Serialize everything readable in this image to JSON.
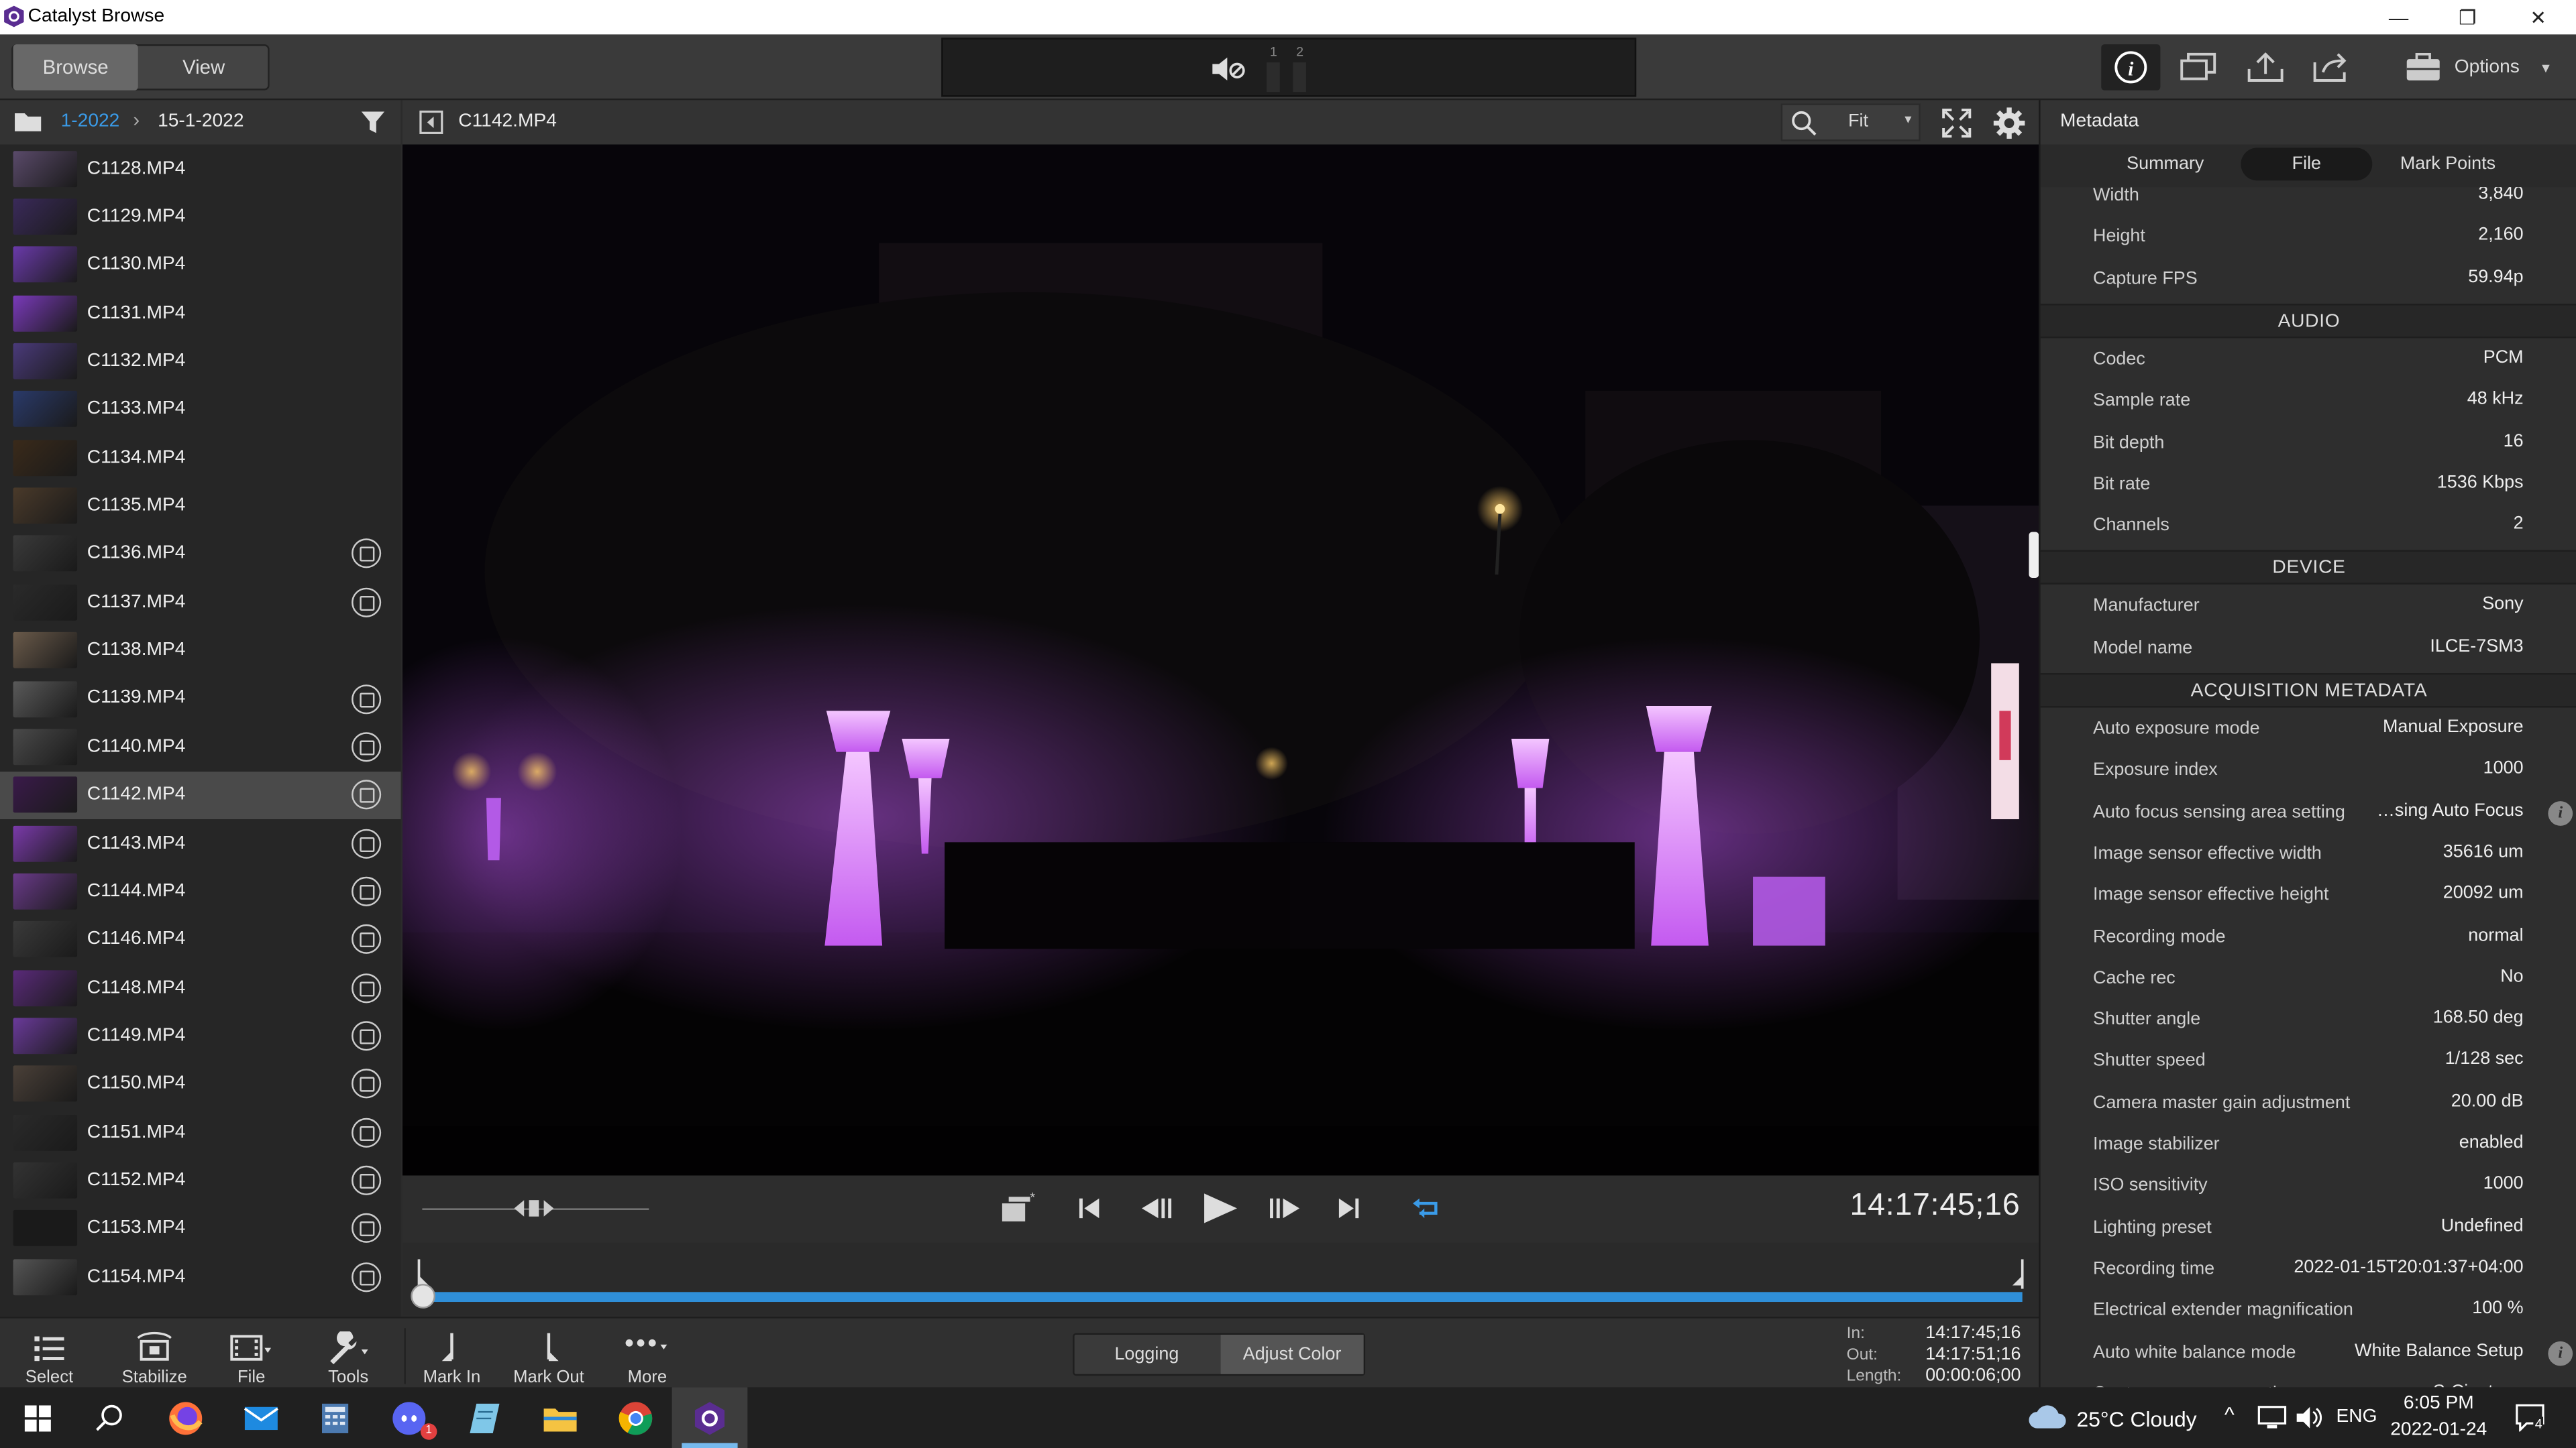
{
  "window": {
    "title": "Catalyst Browse",
    "controls": [
      "—",
      "❐",
      "✕"
    ]
  },
  "toolbar": {
    "browse_label": "Browse",
    "view_label": "View",
    "options_label": "Options",
    "channels": [
      "1",
      "2"
    ]
  },
  "path": {
    "folder_parent": "1-2022",
    "folder_current": "15-1-2022"
  },
  "clips": [
    {
      "name": "C1128.MP4",
      "proxy": false,
      "thumb": "#5a4a6a"
    },
    {
      "name": "C1129.MP4",
      "proxy": false,
      "thumb": "#3a2a5a"
    },
    {
      "name": "C1130.MP4",
      "proxy": false,
      "thumb": "#6a3aaa"
    },
    {
      "name": "C1131.MP4",
      "proxy": false,
      "thumb": "#7a3aba"
    },
    {
      "name": "C1132.MP4",
      "proxy": false,
      "thumb": "#4a3a7a"
    },
    {
      "name": "C1133.MP4",
      "proxy": false,
      "thumb": "#2a3a6a"
    },
    {
      "name": "C1134.MP4",
      "proxy": false,
      "thumb": "#3a2a1a"
    },
    {
      "name": "C1135.MP4",
      "proxy": false,
      "thumb": "#4a3a2a"
    },
    {
      "name": "C1136.MP4",
      "proxy": true,
      "thumb": "#3a3a3a"
    },
    {
      "name": "C1137.MP4",
      "proxy": true,
      "thumb": "#2a2a2a"
    },
    {
      "name": "C1138.MP4",
      "proxy": false,
      "thumb": "#6a5a4a"
    },
    {
      "name": "C1139.MP4",
      "proxy": true,
      "thumb": "#5a5a5a"
    },
    {
      "name": "C1140.MP4",
      "proxy": true,
      "thumb": "#4a4a4a"
    },
    {
      "name": "C1142.MP4",
      "proxy": true,
      "thumb": "#3a1a4a"
    },
    {
      "name": "C1143.MP4",
      "proxy": true,
      "thumb": "#7a3aaa"
    },
    {
      "name": "C1144.MP4",
      "proxy": true,
      "thumb": "#6a3a8a"
    },
    {
      "name": "C1146.MP4",
      "proxy": true,
      "thumb": "#3a3a3a"
    },
    {
      "name": "C1148.MP4",
      "proxy": true,
      "thumb": "#5a2a7a"
    },
    {
      "name": "C1149.MP4",
      "proxy": true,
      "thumb": "#6a3a9a"
    },
    {
      "name": "C1150.MP4",
      "proxy": true,
      "thumb": "#4a4038"
    },
    {
      "name": "C1151.MP4",
      "proxy": true,
      "thumb": "#2a2a2a"
    },
    {
      "name": "C1152.MP4",
      "proxy": true,
      "thumb": "#333333"
    },
    {
      "name": "C1153.MP4",
      "proxy": true,
      "thumb": "#1a1a1a"
    },
    {
      "name": "C1154.MP4",
      "proxy": true,
      "thumb": "#555555"
    }
  ],
  "selected_clip_index": 13,
  "viewer": {
    "clip_name": "C1142.MP4",
    "zoom": "Fit",
    "timecode": "14:17:45;16",
    "playhead_fraction": 0.0
  },
  "bottom_tools": {
    "select": "Select",
    "stabilize": "Stabilize",
    "file": "File",
    "tools": "Tools",
    "mark_in": "Mark In",
    "mark_out": "Mark Out",
    "more": "More",
    "logging": "Logging",
    "adjust_color": "Adjust Color"
  },
  "inout": {
    "in_label": "In:",
    "out_label": "Out:",
    "length_label": "Length:",
    "in": "14:17:45;16",
    "out": "14:17:51;16",
    "length": "00:00:06;00"
  },
  "metadata": {
    "panel_title": "Metadata",
    "tabs": [
      "Summary",
      "File",
      "Mark Points"
    ],
    "active_tab": "File",
    "video_rows": [
      {
        "k": "Width",
        "v": "3,840"
      },
      {
        "k": "Height",
        "v": "2,160"
      },
      {
        "k": "Capture FPS",
        "v": "59.94p"
      }
    ],
    "audio_title": "AUDIO",
    "audio_rows": [
      {
        "k": "Codec",
        "v": "PCM"
      },
      {
        "k": "Sample rate",
        "v": "48 kHz"
      },
      {
        "k": "Bit depth",
        "v": "16"
      },
      {
        "k": "Bit rate",
        "v": "1536 Kbps"
      },
      {
        "k": "Channels",
        "v": "2"
      }
    ],
    "device_title": "DEVICE",
    "device_rows": [
      {
        "k": "Manufacturer",
        "v": "Sony"
      },
      {
        "k": "Model name",
        "v": "ILCE-7SM3"
      }
    ],
    "acq_title": "ACQUISITION METADATA",
    "acq_rows": [
      {
        "k": "Auto exposure mode",
        "v": "Manual Exposure"
      },
      {
        "k": "Exposure index",
        "v": "1000"
      },
      {
        "k": "Auto focus sensing area setting",
        "v": "…sing Auto Focus",
        "info": true
      },
      {
        "k": "Image sensor effective width",
        "v": "35616 um"
      },
      {
        "k": "Image sensor effective height",
        "v": "20092 um"
      },
      {
        "k": "Recording mode",
        "v": "normal"
      },
      {
        "k": "Cache rec",
        "v": "No"
      },
      {
        "k": "Shutter angle",
        "v": "168.50 deg"
      },
      {
        "k": "Shutter speed",
        "v": "1/128 sec"
      },
      {
        "k": "Camera master gain adjustment",
        "v": "20.00 dB"
      },
      {
        "k": "Image stabilizer",
        "v": "enabled"
      },
      {
        "k": "ISO sensitivity",
        "v": "1000"
      },
      {
        "k": "Lighting preset",
        "v": "Undefined"
      },
      {
        "k": "Recording time",
        "v": "2022-01-15T20:01:37+04:00"
      },
      {
        "k": "Electrical extender magnification",
        "v": "100 %"
      },
      {
        "k": "Auto white balance mode",
        "v": "White Balance Setup",
        "info": true
      },
      {
        "k": "Capture gamma equation",
        "v": "S-Cinetone"
      }
    ]
  },
  "taskbar": {
    "weather": "25°C  Cloudy",
    "lang": "ENG",
    "time": "6:05 PM",
    "date": "2022-01-24",
    "notif_count": "4",
    "discord_badge": "1",
    "apps": [
      "firefox-icon",
      "mail-icon",
      "calculator-icon",
      "discord-icon",
      "notepad-icon",
      "file-explorer-icon",
      "chrome-icon",
      "catalyst-icon"
    ]
  },
  "colors": {
    "accent_blue": "#2a8ad4",
    "app_bg": "#2b2b2b",
    "purple_light": "#c070f0"
  }
}
